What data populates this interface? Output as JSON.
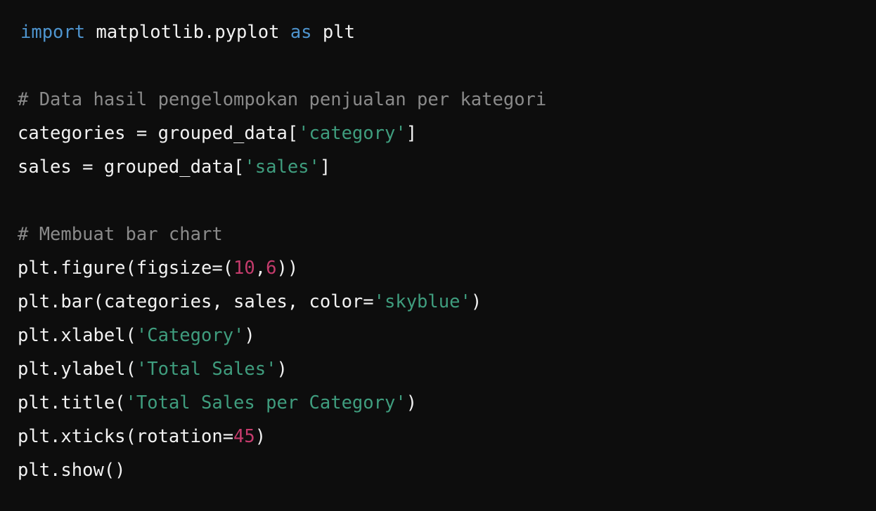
{
  "editor": {
    "language": "python",
    "theme": "dark",
    "background_color": "#0d0d0d",
    "colors": {
      "plain": "#f2f2f2",
      "keyword": "#4e94ce",
      "comment": "#8a8a8a",
      "string": "#3f9d7e",
      "number": "#c43b6c"
    }
  },
  "lines": [
    {
      "index": 0,
      "text": "import matplotlib.pyplot as plt",
      "tokens": [
        {
          "t": "import",
          "c": "keyword"
        },
        {
          "t": " matplotlib.pyplot ",
          "c": "plain"
        },
        {
          "t": "as",
          "c": "keyword"
        },
        {
          "t": " plt",
          "c": "plain"
        }
      ]
    },
    {
      "index": 1,
      "text": "",
      "tokens": []
    },
    {
      "index": 2,
      "text": "# Data hasil pengelompokan penjualan per kategori",
      "tokens": [
        {
          "t": "# Data hasil pengelompokan penjualan per kategori",
          "c": "comment"
        }
      ]
    },
    {
      "index": 3,
      "text": "categories = grouped_data['category']",
      "tokens": [
        {
          "t": "categories = grouped_data[",
          "c": "plain"
        },
        {
          "t": "'category'",
          "c": "string"
        },
        {
          "t": "]",
          "c": "plain"
        }
      ]
    },
    {
      "index": 4,
      "text": "sales = grouped_data['sales']",
      "tokens": [
        {
          "t": "sales = grouped_data[",
          "c": "plain"
        },
        {
          "t": "'sales'",
          "c": "string"
        },
        {
          "t": "]",
          "c": "plain"
        }
      ]
    },
    {
      "index": 5,
      "text": "",
      "tokens": []
    },
    {
      "index": 6,
      "text": "# Membuat bar chart",
      "tokens": [
        {
          "t": "# Membuat bar chart",
          "c": "comment"
        }
      ]
    },
    {
      "index": 7,
      "text": "plt.figure(figsize=(10,6))",
      "tokens": [
        {
          "t": "plt.figure(figsize=(",
          "c": "plain"
        },
        {
          "t": "10",
          "c": "number"
        },
        {
          "t": ",",
          "c": "plain"
        },
        {
          "t": "6",
          "c": "number"
        },
        {
          "t": "))",
          "c": "plain"
        }
      ]
    },
    {
      "index": 8,
      "text": "plt.bar(categories, sales, color='skyblue')",
      "tokens": [
        {
          "t": "plt.bar(categories, sales, color=",
          "c": "plain"
        },
        {
          "t": "'skyblue'",
          "c": "string"
        },
        {
          "t": ")",
          "c": "plain"
        }
      ]
    },
    {
      "index": 9,
      "text": "plt.xlabel('Category')",
      "tokens": [
        {
          "t": "plt.xlabel(",
          "c": "plain"
        },
        {
          "t": "'Category'",
          "c": "string"
        },
        {
          "t": ")",
          "c": "plain"
        }
      ]
    },
    {
      "index": 10,
      "text": "plt.ylabel('Total Sales')",
      "tokens": [
        {
          "t": "plt.ylabel(",
          "c": "plain"
        },
        {
          "t": "'Total Sales'",
          "c": "string"
        },
        {
          "t": ")",
          "c": "plain"
        }
      ]
    },
    {
      "index": 11,
      "text": "plt.title('Total Sales per Category')",
      "tokens": [
        {
          "t": "plt.title(",
          "c": "plain"
        },
        {
          "t": "'Total Sales per Category'",
          "c": "string"
        },
        {
          "t": ")",
          "c": "plain"
        }
      ]
    },
    {
      "index": 12,
      "text": "plt.xticks(rotation=45)",
      "tokens": [
        {
          "t": "plt.xticks(rotation=",
          "c": "plain"
        },
        {
          "t": "45",
          "c": "number"
        },
        {
          "t": ")",
          "c": "plain"
        }
      ]
    },
    {
      "index": 13,
      "text": "plt.show()",
      "tokens": [
        {
          "t": "plt.show()",
          "c": "plain"
        }
      ]
    }
  ]
}
